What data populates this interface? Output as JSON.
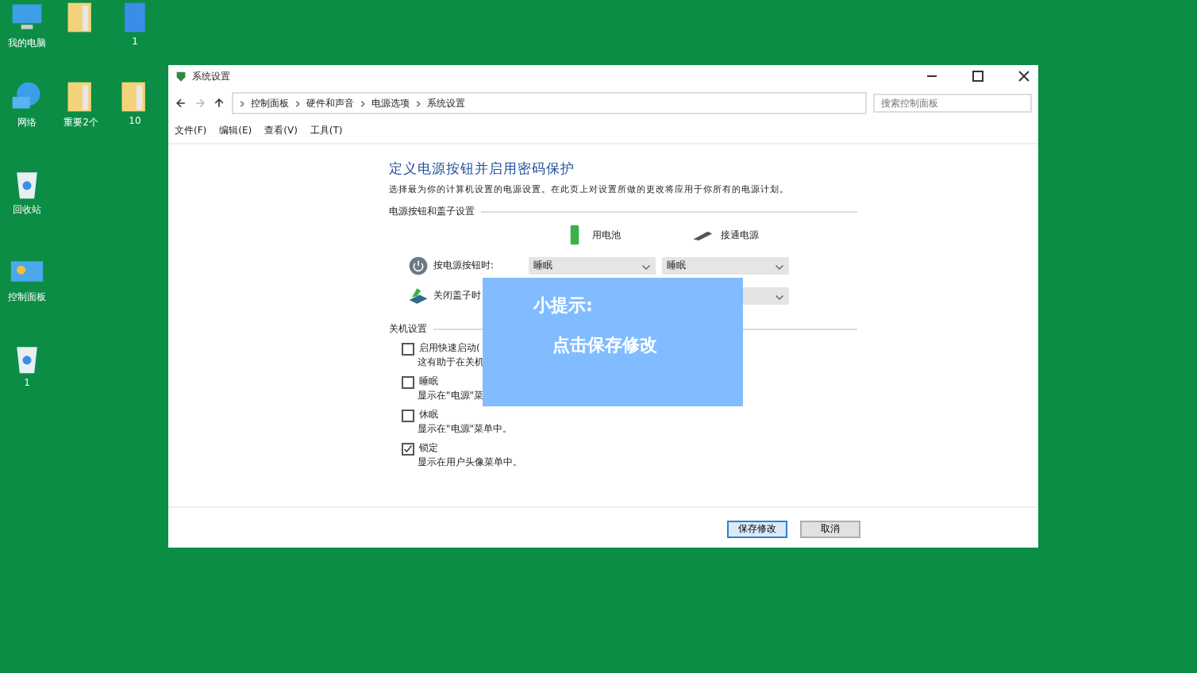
{
  "desktop_icons": [
    {
      "kind": "computer",
      "label": "我的电脑"
    },
    {
      "kind": "folder"
    },
    {
      "kind": "file",
      "label": "1"
    },
    {
      "kind": "network",
      "label": "网络"
    },
    {
      "kind": "folder",
      "label": "重要2个"
    },
    {
      "kind": "folder",
      "label": "10"
    },
    {
      "kind": "recycle",
      "label": "回收站"
    },
    {
      "kind": "control",
      "label": "控制面板"
    },
    {
      "kind": "recycle",
      "label": "1"
    }
  ],
  "window": {
    "title": "系统设置",
    "breadcrumb": [
      "控制面板",
      "硬件和声音",
      "电源选项",
      "系统设置"
    ],
    "search": {
      "placeholder": "搜索控制面板"
    },
    "menu": [
      "文件(F)",
      "编辑(E)",
      "查看(V)",
      "工具(T)"
    ],
    "heading": "定义电源按钮并启用密码保护",
    "description": "选择最为你的计算机设置的电源设置。在此页上对设置所做的更改将应用于你所有的电源计划。",
    "power_section": {
      "title": "电源按钮和盖子设置",
      "columns": [
        {
          "kind": "battery",
          "label": "用电池"
        },
        {
          "kind": "plug",
          "label": "接通电源"
        }
      ],
      "rows": [
        {
          "kind": "power",
          "label": "按电源按钮时:",
          "values": [
            "睡眠",
            "睡眠"
          ]
        },
        {
          "kind": "lid",
          "label": "关闭盖子时"
        }
      ]
    },
    "shutdown_section": {
      "title": "关机设置",
      "options": [
        {
          "label": "启用快速启动(",
          "description": "这有助于在关机",
          "checked": false
        },
        {
          "label": "睡眠",
          "description": "显示在\"电源\"菜",
          "checked": false
        },
        {
          "label": "休眠",
          "description": "显示在\"电源\"菜单中。",
          "checked": false
        },
        {
          "label": "锁定",
          "description": "显示在用户头像菜单中。",
          "checked": true
        }
      ]
    },
    "buttons": [
      {
        "label": "保存修改",
        "primary": true
      },
      {
        "label": "取消",
        "primary": false
      }
    ]
  },
  "tip": {
    "title": "小提示:",
    "text": "点击保存修改"
  }
}
